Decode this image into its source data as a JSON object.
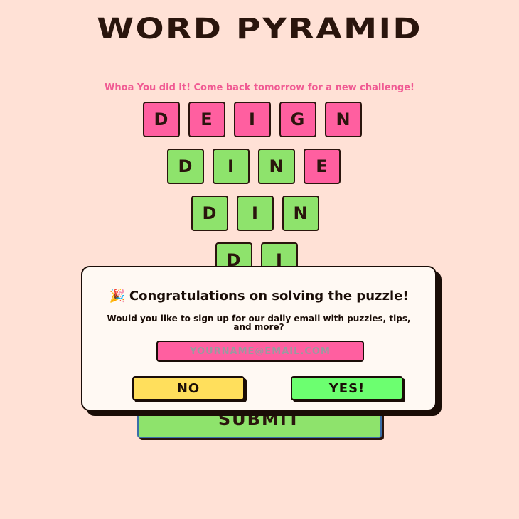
{
  "title": "WORD PYRAMID",
  "message": "Whoa You did it! Come back tomorrow for a new challenge!",
  "rows": [
    [
      {
        "letter": "D",
        "state": "pink"
      },
      {
        "letter": "E",
        "state": "pink"
      },
      {
        "letter": "I",
        "state": "pink"
      },
      {
        "letter": "G",
        "state": "pink"
      },
      {
        "letter": "N",
        "state": "pink"
      }
    ],
    [
      {
        "letter": "D",
        "state": "green"
      },
      {
        "letter": "I",
        "state": "green"
      },
      {
        "letter": "N",
        "state": "green"
      },
      {
        "letter": "E",
        "state": "pink"
      }
    ],
    [
      {
        "letter": "D",
        "state": "green"
      },
      {
        "letter": "I",
        "state": "green"
      },
      {
        "letter": "N",
        "state": "green"
      }
    ],
    [
      {
        "letter": "D",
        "state": "green"
      },
      {
        "letter": "I",
        "state": "green"
      }
    ]
  ],
  "submit_label": "SUBMIT",
  "modal": {
    "title": "Congratulations on solving the puzzle!",
    "icon": "party-popper-icon",
    "icon_glyph": "🎉",
    "body": "Would you like to sign up for our daily email with puzzles, tips, and more?",
    "email_placeholder": "YOURNAME@EMAIL.COM",
    "no_label": "NO",
    "yes_label": "YES!"
  },
  "colors": {
    "background": "#ffe1d6",
    "pink": "#ff5fa0",
    "green": "#8ee36c",
    "yellow": "#ffdf5c",
    "yes_green": "#6cff70",
    "message": "#f05a93"
  }
}
